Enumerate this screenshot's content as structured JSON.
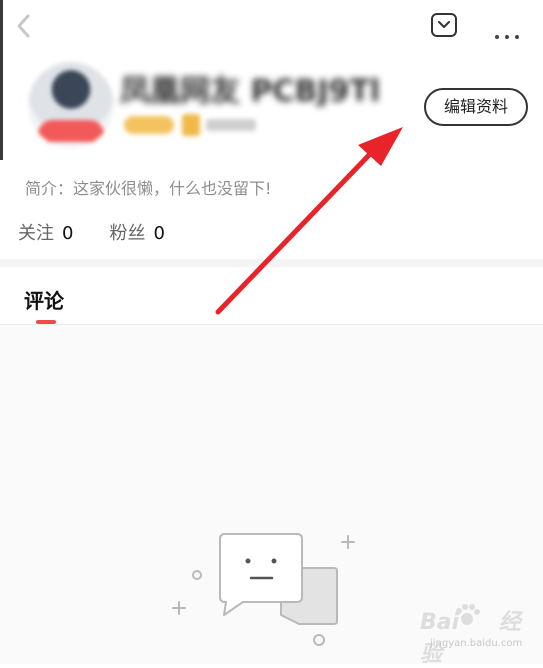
{
  "header": {
    "back_icon": "chevron-left-icon",
    "dropdown_icon": "chevron-down-box-icon",
    "more_icon": "more-dots-icon"
  },
  "profile": {
    "username": "凤凰网友 PCBJ9Tl",
    "edit_button_label": "编辑资料",
    "bio": "简介：这家伙很懒，什么也没留下!"
  },
  "stats": {
    "following_label": "关注",
    "following_count": "0",
    "followers_label": "粉丝",
    "followers_count": "0"
  },
  "tabs": [
    {
      "label": "评论",
      "active": true
    }
  ],
  "colors": {
    "accent": "#f04b4b",
    "arrow": "#e8232a",
    "text": "#222222",
    "muted": "#8e8e8e"
  },
  "empty_state": {
    "icon": "empty-chat-bubbles-icon"
  },
  "watermark": {
    "brand": "Bai",
    "brand_tail": "经验",
    "url": "jingyan.baidu.com"
  }
}
